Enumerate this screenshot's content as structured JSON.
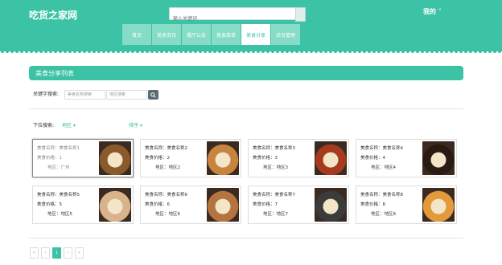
{
  "header": {
    "logo": "吃货之家网",
    "search_placeholder": "输入关键词",
    "user": "我的",
    "bg_color": "#3cc2a4",
    "nav": [
      {
        "label": "首页",
        "active": false
      },
      {
        "label": "美食资讯",
        "active": false
      },
      {
        "label": "餐厅公告",
        "active": false
      },
      {
        "label": "美食菜单",
        "active": false
      },
      {
        "label": "美食分享",
        "active": true
      },
      {
        "label": "后台管理",
        "active": false
      }
    ]
  },
  "main": {
    "title": "美食分享列表",
    "keyword_label": "关键字搜索:",
    "keyword_placeholder_1": "美食名称搜索",
    "keyword_placeholder_2": "地区搜索",
    "dropdown_label": "下拉搜索:",
    "dropdown_1": "地区",
    "dropdown_2": "排序"
  },
  "cards": [
    {
      "name": "美食名称：美食名称1",
      "price": "美食价格：1",
      "region": "地区：广州",
      "img_color": "#8b5a2b"
    },
    {
      "name": "美食名称：美食名称2",
      "price": "美食价格：2",
      "region": "地区：地区2",
      "img_color": "#c7843f"
    },
    {
      "name": "美食名称：美食名称3",
      "price": "美食价格：3",
      "region": "地区：地区3",
      "img_color": "#a63a1f"
    },
    {
      "name": "美食名称：美食名称4",
      "price": "美食价格：4",
      "region": "地区：地区4",
      "img_color": "#2b1a14"
    },
    {
      "name": "美食名称：美食名称5",
      "price": "美食价格：5",
      "region": "地区：地区5",
      "img_color": "#d9b38c"
    },
    {
      "name": "美食名称：美食名称6",
      "price": "美食价格：6",
      "region": "地区：地区6",
      "img_color": "#b5733f"
    },
    {
      "name": "美食名称：美食名称7",
      "price": "美食价格：7",
      "region": "地区：地区7",
      "img_color": "#3b3b3b"
    },
    {
      "name": "美食名称：美食名称8",
      "price": "美食价格：8",
      "region": "地区：地区8",
      "img_color": "#e29a3a"
    }
  ],
  "pager": {
    "items": [
      "«",
      "‹",
      "1",
      "›",
      "»"
    ],
    "active_index": 2
  }
}
